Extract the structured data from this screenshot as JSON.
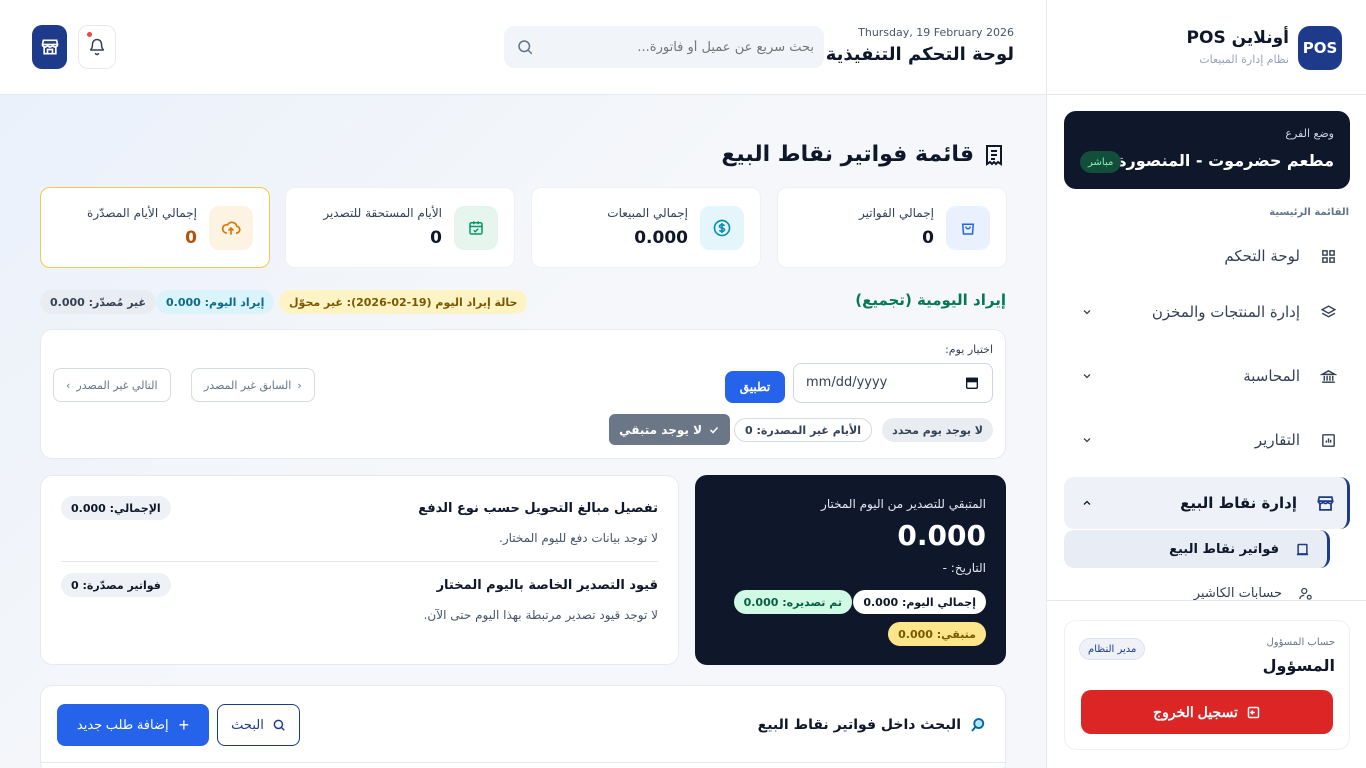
{
  "brand": {
    "logo": "POS",
    "name": "أونلاين POS",
    "subtitle": "نظام إدارة المبيعات"
  },
  "branch": {
    "label": "وضع الفرع",
    "name": "مطعم حضرموت - المنصورة",
    "badge": "مباشر"
  },
  "nav": {
    "section_title": "القائمة الرئيسية",
    "items": [
      {
        "label": "لوحة التحكم",
        "icon": "grid-icon",
        "has_chevron": false
      },
      {
        "label": "إدارة المنتجات والمخزن",
        "icon": "layers-icon",
        "has_chevron": true
      },
      {
        "label": "المحاسبة",
        "icon": "bank-icon",
        "has_chevron": true
      },
      {
        "label": "التقارير",
        "icon": "chart-icon",
        "has_chevron": true
      },
      {
        "label": "إدارة نقاط البيع",
        "icon": "store-icon",
        "has_chevron": true,
        "active": true
      }
    ],
    "sub_items": [
      {
        "label": "فواتير نقاط البيع",
        "icon": "receipt-icon",
        "active": true
      },
      {
        "label": "حسابات الكاشير",
        "icon": "user-cog-icon"
      }
    ]
  },
  "account": {
    "label": "حساب المسؤول",
    "name": "المسؤول",
    "role": "مدير النظام",
    "logout": "تسجيل الخروج"
  },
  "header": {
    "date": "Thursday, 19 February 2026",
    "title": "لوحة التحكم التنفيذية",
    "search_placeholder": "بحث سريع عن عميل أو فاتورة...",
    "notification_dot_color": "#ef4444"
  },
  "page": {
    "title": "قائمة فواتير نقاط البيع",
    "stats": [
      {
        "label": "إجمالي الفواتير",
        "value": "0",
        "icon": "bag-icon",
        "color": "#2563eb",
        "bg": "#eaf1fe"
      },
      {
        "label": "إجمالي المبيعات",
        "value": "0.000",
        "icon": "dollar-icon",
        "color": "#0891b2",
        "bg": "#e4f6fb"
      },
      {
        "label": "الأيام المستحقة للتصدير",
        "value": "0",
        "icon": "calendar-check-icon",
        "color": "#059669",
        "bg": "#e6f6ef"
      },
      {
        "label": "إجمالي الأيام المصدّرة",
        "value": "0",
        "icon": "cloud-upload-icon",
        "color": "#d97706",
        "bg": "#fdf3e2"
      }
    ]
  },
  "daily": {
    "title": "إيراد اليومية (تجميع)",
    "status": "حالة إيراد اليوم (19-02-2026): غير محوّل",
    "today_revenue": "إيراد اليوم: 0.000",
    "not_exported": "غير مُصدّر: 0.000"
  },
  "filter": {
    "label": "اختيار يوم:",
    "date_placeholder": "mm/dd/yyyy",
    "apply": "تطبيق",
    "prev": "السابق غير المصدر",
    "next": "التالي غير المصدر",
    "chip_no_day": "لا يوجد يوم محدد",
    "chip_unexported_days": "الأيام غير المصدرة: 0",
    "chip_no_remaining": "لا يوجد متبقي"
  },
  "remaining": {
    "label": "المتبقي للتصدير من اليوم المختار",
    "value": "0.000",
    "date": "التاريخ: -",
    "total_today": "إجمالي اليوم: 0.000",
    "exported": "تم تصديره: 0.000",
    "left": "متبقي: 0.000"
  },
  "details": {
    "transfer_title": "تفصيل مبالغ التحويل حسب نوع الدفع",
    "transfer_total": "الإجمالي: 0.000",
    "transfer_empty": "لا توجد بيانات دفع لليوم المختار.",
    "export_title": "قيود التصدير الخاصة باليوم المختار",
    "exported_invoices": "فواتير مصدّرة: 0",
    "export_empty": "لا توجد قيود تصدير مرتبطة بهذا اليوم حتى الآن."
  },
  "search_section": {
    "title": "البحث داخل فواتير نقاط البيع",
    "search_button": "البحث",
    "add_button": "إضافة طلب جديد"
  }
}
